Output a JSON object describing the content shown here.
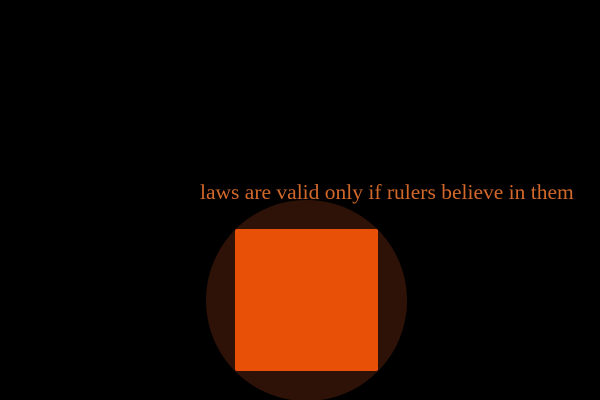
{
  "caption": {
    "text": "laws are valid only if rulers believe in them"
  },
  "colors": {
    "background": "#000000",
    "text": "#d3682b",
    "circle": "#2e1207",
    "square": "#e84f07"
  }
}
